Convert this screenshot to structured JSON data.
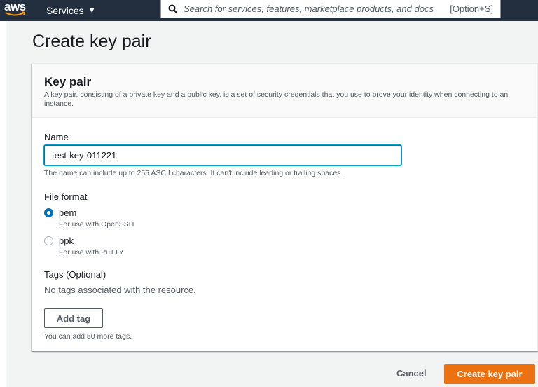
{
  "nav": {
    "logo_text": "aws",
    "services_label": "Services",
    "search_placeholder": "Search for services, features, marketplace products, and docs",
    "search_shortcut": "[Option+S]"
  },
  "page": {
    "title": "Create key pair"
  },
  "key_pair": {
    "heading": "Key pair",
    "description": "A key pair, consisting of a private key and a public key, is a set of security credentials that you use to prove your identity when connecting to an instance.",
    "name_label": "Name",
    "name_value": "test-key-011221",
    "name_hint": "The name can include up to 255 ASCII characters. It can't include leading or trailing spaces.",
    "file_format_label": "File format",
    "formats": [
      {
        "label": "pem",
        "sub": "For use with OpenSSH",
        "checked": true
      },
      {
        "label": "ppk",
        "sub": "For use with PuTTY",
        "checked": false
      }
    ],
    "tags_label": "Tags (Optional)",
    "tags_empty": "No tags associated with the resource.",
    "add_tag_label": "Add tag",
    "tags_hint": "You can add 50 more tags."
  },
  "footer": {
    "cancel_label": "Cancel",
    "create_label": "Create key pair"
  },
  "colors": {
    "nav_bg": "#232f3e",
    "primary": "#ec7211",
    "focus_blue": "#0073bb"
  }
}
